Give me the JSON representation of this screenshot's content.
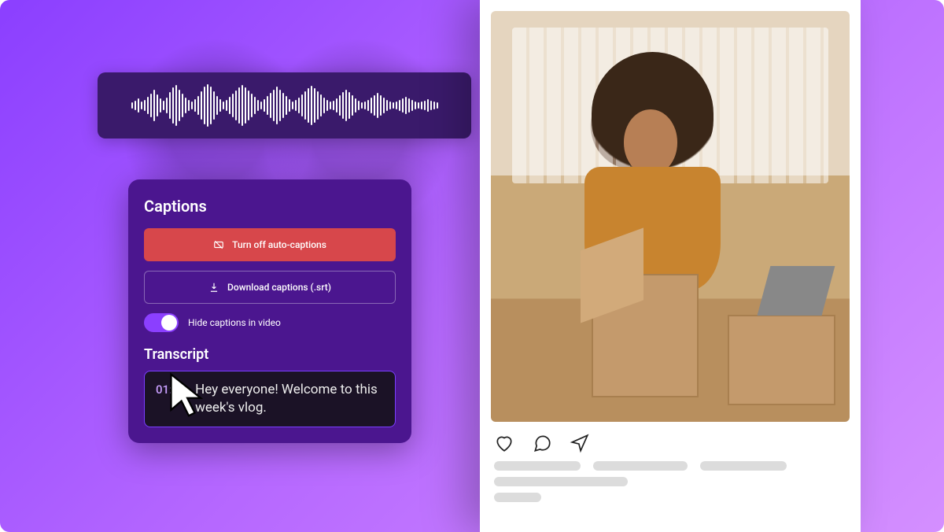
{
  "captions_panel": {
    "title": "Captions",
    "turn_off_label": "Turn off auto-captions",
    "download_label": "Download captions (.srt)",
    "hide_toggle_label": "Hide captions in video",
    "hide_toggle_on": true
  },
  "transcript": {
    "title": "Transcript",
    "entries": [
      {
        "time": "01:00",
        "text": "Hey everyone! Welcome to this week's vlog."
      }
    ]
  },
  "waveform": {
    "description": "audio-waveform"
  },
  "social_post": {
    "image_alt": "Woman packing cardboard boxes in a bright office",
    "like_icon": "heart-icon",
    "comment_icon": "speech-bubble-icon",
    "share_icon": "paper-plane-icon"
  }
}
